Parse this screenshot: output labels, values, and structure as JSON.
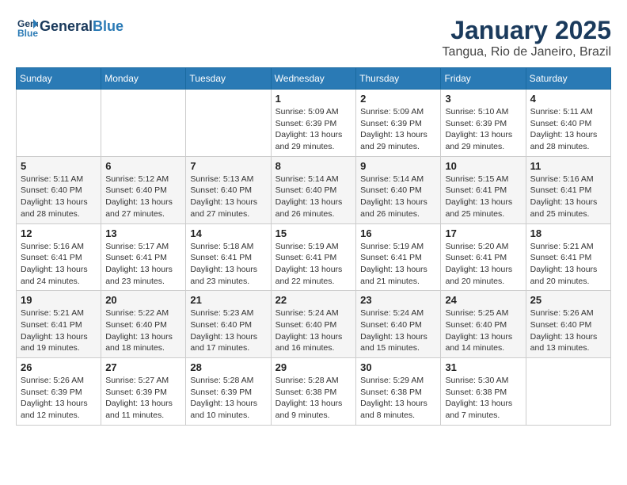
{
  "header": {
    "logo_line1": "General",
    "logo_line2": "Blue",
    "month_title": "January 2025",
    "location": "Tangua, Rio de Janeiro, Brazil"
  },
  "days_of_week": [
    "Sunday",
    "Monday",
    "Tuesday",
    "Wednesday",
    "Thursday",
    "Friday",
    "Saturday"
  ],
  "weeks": [
    [
      {
        "day": "",
        "info": ""
      },
      {
        "day": "",
        "info": ""
      },
      {
        "day": "",
        "info": ""
      },
      {
        "day": "1",
        "info": "Sunrise: 5:09 AM\nSunset: 6:39 PM\nDaylight: 13 hours\nand 29 minutes."
      },
      {
        "day": "2",
        "info": "Sunrise: 5:09 AM\nSunset: 6:39 PM\nDaylight: 13 hours\nand 29 minutes."
      },
      {
        "day": "3",
        "info": "Sunrise: 5:10 AM\nSunset: 6:39 PM\nDaylight: 13 hours\nand 29 minutes."
      },
      {
        "day": "4",
        "info": "Sunrise: 5:11 AM\nSunset: 6:40 PM\nDaylight: 13 hours\nand 28 minutes."
      }
    ],
    [
      {
        "day": "5",
        "info": "Sunrise: 5:11 AM\nSunset: 6:40 PM\nDaylight: 13 hours\nand 28 minutes."
      },
      {
        "day": "6",
        "info": "Sunrise: 5:12 AM\nSunset: 6:40 PM\nDaylight: 13 hours\nand 27 minutes."
      },
      {
        "day": "7",
        "info": "Sunrise: 5:13 AM\nSunset: 6:40 PM\nDaylight: 13 hours\nand 27 minutes."
      },
      {
        "day": "8",
        "info": "Sunrise: 5:14 AM\nSunset: 6:40 PM\nDaylight: 13 hours\nand 26 minutes."
      },
      {
        "day": "9",
        "info": "Sunrise: 5:14 AM\nSunset: 6:40 PM\nDaylight: 13 hours\nand 26 minutes."
      },
      {
        "day": "10",
        "info": "Sunrise: 5:15 AM\nSunset: 6:41 PM\nDaylight: 13 hours\nand 25 minutes."
      },
      {
        "day": "11",
        "info": "Sunrise: 5:16 AM\nSunset: 6:41 PM\nDaylight: 13 hours\nand 25 minutes."
      }
    ],
    [
      {
        "day": "12",
        "info": "Sunrise: 5:16 AM\nSunset: 6:41 PM\nDaylight: 13 hours\nand 24 minutes."
      },
      {
        "day": "13",
        "info": "Sunrise: 5:17 AM\nSunset: 6:41 PM\nDaylight: 13 hours\nand 23 minutes."
      },
      {
        "day": "14",
        "info": "Sunrise: 5:18 AM\nSunset: 6:41 PM\nDaylight: 13 hours\nand 23 minutes."
      },
      {
        "day": "15",
        "info": "Sunrise: 5:19 AM\nSunset: 6:41 PM\nDaylight: 13 hours\nand 22 minutes."
      },
      {
        "day": "16",
        "info": "Sunrise: 5:19 AM\nSunset: 6:41 PM\nDaylight: 13 hours\nand 21 minutes."
      },
      {
        "day": "17",
        "info": "Sunrise: 5:20 AM\nSunset: 6:41 PM\nDaylight: 13 hours\nand 20 minutes."
      },
      {
        "day": "18",
        "info": "Sunrise: 5:21 AM\nSunset: 6:41 PM\nDaylight: 13 hours\nand 20 minutes."
      }
    ],
    [
      {
        "day": "19",
        "info": "Sunrise: 5:21 AM\nSunset: 6:41 PM\nDaylight: 13 hours\nand 19 minutes."
      },
      {
        "day": "20",
        "info": "Sunrise: 5:22 AM\nSunset: 6:40 PM\nDaylight: 13 hours\nand 18 minutes."
      },
      {
        "day": "21",
        "info": "Sunrise: 5:23 AM\nSunset: 6:40 PM\nDaylight: 13 hours\nand 17 minutes."
      },
      {
        "day": "22",
        "info": "Sunrise: 5:24 AM\nSunset: 6:40 PM\nDaylight: 13 hours\nand 16 minutes."
      },
      {
        "day": "23",
        "info": "Sunrise: 5:24 AM\nSunset: 6:40 PM\nDaylight: 13 hours\nand 15 minutes."
      },
      {
        "day": "24",
        "info": "Sunrise: 5:25 AM\nSunset: 6:40 PM\nDaylight: 13 hours\nand 14 minutes."
      },
      {
        "day": "25",
        "info": "Sunrise: 5:26 AM\nSunset: 6:40 PM\nDaylight: 13 hours\nand 13 minutes."
      }
    ],
    [
      {
        "day": "26",
        "info": "Sunrise: 5:26 AM\nSunset: 6:39 PM\nDaylight: 13 hours\nand 12 minutes."
      },
      {
        "day": "27",
        "info": "Sunrise: 5:27 AM\nSunset: 6:39 PM\nDaylight: 13 hours\nand 11 minutes."
      },
      {
        "day": "28",
        "info": "Sunrise: 5:28 AM\nSunset: 6:39 PM\nDaylight: 13 hours\nand 10 minutes."
      },
      {
        "day": "29",
        "info": "Sunrise: 5:28 AM\nSunset: 6:38 PM\nDaylight: 13 hours\nand 9 minutes."
      },
      {
        "day": "30",
        "info": "Sunrise: 5:29 AM\nSunset: 6:38 PM\nDaylight: 13 hours\nand 8 minutes."
      },
      {
        "day": "31",
        "info": "Sunrise: 5:30 AM\nSunset: 6:38 PM\nDaylight: 13 hours\nand 7 minutes."
      },
      {
        "day": "",
        "info": ""
      }
    ]
  ]
}
